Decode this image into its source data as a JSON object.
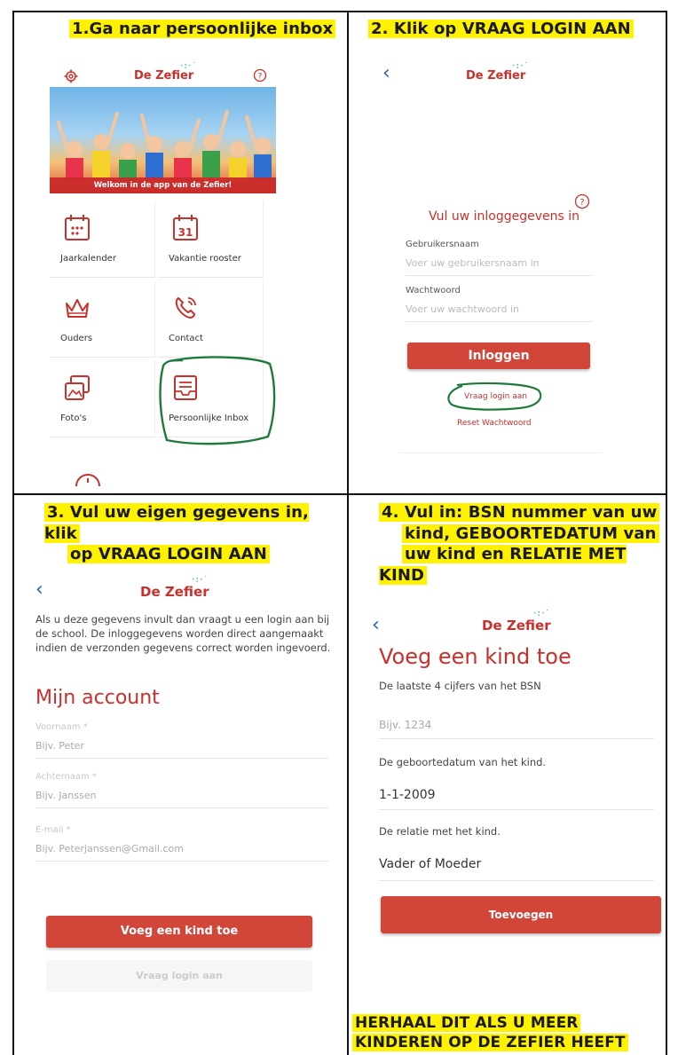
{
  "steps": [
    {
      "title": "1.Ga naar persoonlijke inbox"
    },
    {
      "title": "2. Klik op VRAAG LOGIN AAN"
    },
    {
      "title_lines": [
        "3. Vul uw eigen gegevens in, klik",
        "op VRAAG LOGIN AAN"
      ]
    },
    {
      "title_lines": [
        "4. Vul in: BSN nummer van uw",
        "kind, GEBOORTEDATUM van",
        "uw kind en RELATIE MET KIND"
      ]
    }
  ],
  "logo": "De Zefier",
  "colors": {
    "accent": "#d2463a",
    "brand": "#c9302c",
    "highlight": "#fff200",
    "back_arrow": "#2a5ea8",
    "circle": "#1e7a3a"
  },
  "home": {
    "banner_caption": "Welkom in de app van de Zefier!",
    "tiles": [
      {
        "label": "Jaarkalender",
        "icon": "calendar-grid-icon"
      },
      {
        "label": "Vakantie rooster",
        "icon": "calendar-31-icon",
        "badge": "31"
      },
      {
        "label": "Ouders",
        "icon": "crown-icon"
      },
      {
        "label": "Contact",
        "icon": "phone-icon"
      },
      {
        "label": "Foto's",
        "icon": "photos-icon"
      },
      {
        "label": "Persoonlijke Inbox",
        "icon": "inbox-icon"
      }
    ]
  },
  "login": {
    "heading": "Vul uw inloggegevens in",
    "username_label": "Gebruikersnaam",
    "username_placeholder": "Voer uw gebruikersnaam in",
    "password_label": "Wachtwoord",
    "password_placeholder": "Voer uw wachtwoord in",
    "login_button": "Inloggen",
    "request_link": "Vraag login aan",
    "reset_link": "Reset Wachtwoord"
  },
  "account": {
    "intro": "Als u deze gegevens invult dan vraagt u een login aan bij de school. De inloggegevens worden direct aangemaakt indien de verzonden gegevens correct worden ingevoerd.",
    "heading": "Mijn account",
    "first_name_label": "Voornaam *",
    "first_name_placeholder": "Bijv. Peter",
    "last_name_label": "Achternaam *",
    "last_name_placeholder": "Bijv. Janssen",
    "email_label": "E-mail *",
    "email_placeholder": "Bijv. Peterjanssen@Gmail.com",
    "add_child_button": "Voeg een kind toe",
    "request_button": "Vraag login aan"
  },
  "child": {
    "heading": "Voeg een kind toe",
    "bsn_label": "De laatste 4 cijfers van het BSN",
    "bsn_placeholder": "Bijv. 1234",
    "dob_label": "De geboortedatum van het kind.",
    "dob_value": "1-1-2009",
    "relation_label": "De relatie met het kind.",
    "relation_value": "Vader of Moeder",
    "add_button": "Toevoegen"
  },
  "footer_note_lines": [
    "HERHAAL DIT ALS U MEER",
    "KINDEREN OP DE ZEFIER HEEFT"
  ]
}
